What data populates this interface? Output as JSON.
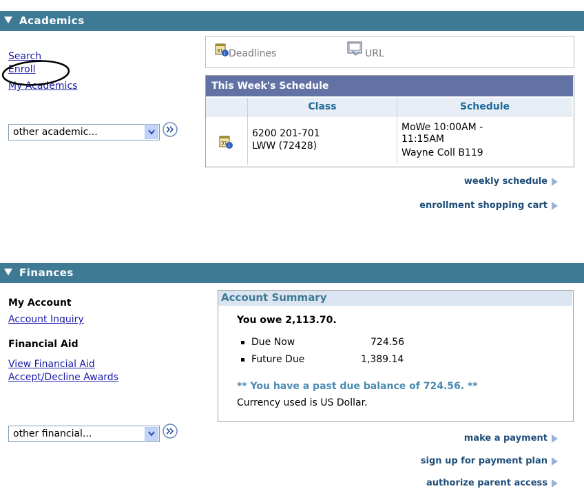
{
  "academics": {
    "title": "Academics",
    "links": {
      "search": "Search",
      "enroll": "Enroll",
      "my_academics": "My Academics"
    },
    "dropdown": {
      "selected": "other academic..."
    },
    "tabs": {
      "deadlines": "Deadlines",
      "url": "URL"
    },
    "schedule": {
      "title": "This Week's Schedule",
      "col_class": "Class",
      "col_schedule": "Schedule",
      "row": {
        "class_line1": "6200 201-701",
        "class_line2": "LWW (72428)",
        "sched_line1": "MoWe 10:00AM -",
        "sched_line2": "11:15AM",
        "sched_line3": "Wayne Coll B119"
      }
    },
    "actions": {
      "weekly": "weekly schedule",
      "cart": "enrollment shopping cart"
    }
  },
  "finances": {
    "title": "Finances",
    "my_account": {
      "heading": "My Account",
      "inquiry": "Account Inquiry"
    },
    "financial_aid": {
      "heading": "Financial Aid",
      "view": "View Financial Aid",
      "accept": "Accept/Decline Awards"
    },
    "dropdown": {
      "selected": "other financial..."
    },
    "summary": {
      "title": "Account Summary",
      "owe": "You owe 2,113.70.",
      "due_now_label": "Due Now",
      "due_now_value": "724.56",
      "future_due_label": "Future Due",
      "future_due_value": "1,389.14",
      "past_due": "** You have a past due balance of 724.56. **",
      "currency": "Currency used is US Dollar."
    },
    "actions": {
      "payment": "make a payment",
      "plan": "sign up for payment plan",
      "parent": "authorize parent access"
    }
  },
  "colors": {
    "section_bar": "#3f7a95",
    "link": "#1a1aa6",
    "schedule_header": "#6272a4",
    "accent_text": "#3f7a95"
  }
}
